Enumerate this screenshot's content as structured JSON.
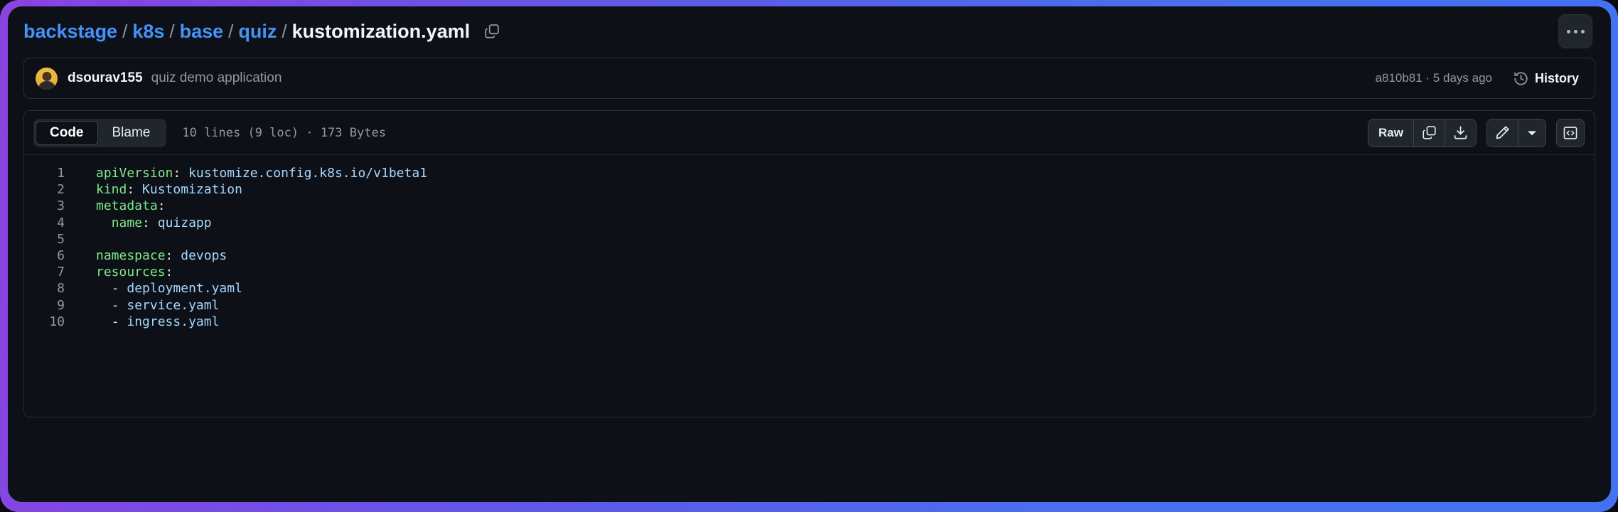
{
  "window": {
    "frame_gradient_start": "#8b43e0",
    "frame_gradient_end": "#4172f2",
    "background": "#0d1117"
  },
  "breadcrumb": {
    "parts": [
      {
        "label": "backstage",
        "type": "link"
      },
      {
        "label": "k8s",
        "type": "link"
      },
      {
        "label": "base",
        "type": "link"
      },
      {
        "label": "quiz",
        "type": "link"
      },
      {
        "label": "kustomization.yaml",
        "type": "current"
      }
    ],
    "separator": "/",
    "copy_path_icon": "copy-icon",
    "link_color": "#4493f8",
    "current_color": "#f0f6fc"
  },
  "header": {
    "kebab_icon": "kebab-horizontal-icon",
    "kebab_label": "..."
  },
  "commit": {
    "avatar": "user-avatar",
    "author": "dsourav155",
    "message": "quiz demo application",
    "hash": "a810b81",
    "separator": "·",
    "relative_time": "5 days ago",
    "meta": "a810b81 · 5 days ago",
    "history_label": "History",
    "history_icon": "history-clock-icon"
  },
  "file_toolbar": {
    "tabs": [
      {
        "label": "Code",
        "active": true
      },
      {
        "label": "Blame",
        "active": false
      }
    ],
    "file_meta": "10 lines (9 loc) · 173 Bytes",
    "lines_count": "10 lines",
    "loc_count": "(9 loc)",
    "file_size": "173 Bytes",
    "raw_label": "Raw",
    "copy_icon": "copy-raw-contents-icon",
    "download_icon": "download-raw-file-icon",
    "edit_icon": "pencil-edit-icon",
    "edit_dropdown_icon": "chevron-down-icon",
    "symbols_icon": "code-brackets-icon"
  },
  "code": {
    "language": "yaml",
    "lines": [
      {
        "num": "1",
        "indent": "",
        "key": "apiVersion",
        "sep": ":",
        "value": " kustomize.config.k8s.io/v1beta1",
        "dash": false
      },
      {
        "num": "2",
        "indent": "",
        "key": "kind",
        "sep": ":",
        "value": " Kustomization",
        "dash": false
      },
      {
        "num": "3",
        "indent": "",
        "key": "metadata",
        "sep": ":",
        "value": "",
        "dash": false
      },
      {
        "num": "4",
        "indent": "  ",
        "key": "name",
        "sep": ":",
        "value": " quizapp",
        "dash": false
      },
      {
        "num": "5",
        "indent": "",
        "key": "",
        "sep": "",
        "value": "",
        "dash": false
      },
      {
        "num": "6",
        "indent": "",
        "key": "namespace",
        "sep": ":",
        "value": " devops",
        "dash": false
      },
      {
        "num": "7",
        "indent": "",
        "key": "resources",
        "sep": ":",
        "value": "",
        "dash": false
      },
      {
        "num": "8",
        "indent": "  ",
        "key": "",
        "sep": "",
        "value": "deployment.yaml",
        "dash": true
      },
      {
        "num": "9",
        "indent": "  ",
        "key": "",
        "sep": "",
        "value": "service.yaml",
        "dash": true
      },
      {
        "num": "10",
        "indent": "  ",
        "key": "",
        "sep": "",
        "value": "ingress.yaml",
        "dash": true
      }
    ],
    "raw_text": "apiVersion: kustomize.config.k8s.io/v1beta1\nkind: Kustomization\nmetadata:\n  name: quizapp\n\nnamespace: devops\nresources:\n  - deployment.yaml\n  - service.yaml\n  - ingress.yaml",
    "colors": {
      "key": "#7ee787",
      "value": "#a5d6ff",
      "punctuation": "#e6edf3",
      "line_number": "#9198a1"
    }
  }
}
